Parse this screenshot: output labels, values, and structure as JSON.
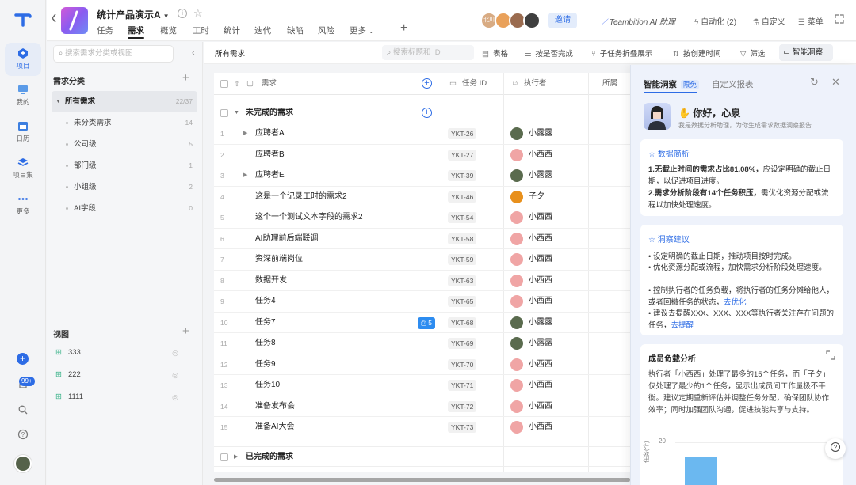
{
  "nav": {
    "items": [
      {
        "label": "项目",
        "icon": "project-icon"
      },
      {
        "label": "我的",
        "icon": "monitor-icon"
      },
      {
        "label": "日历",
        "icon": "calendar-icon"
      },
      {
        "label": "项目集",
        "icon": "layers-icon"
      },
      {
        "label": "更多",
        "icon": "more-icon"
      }
    ],
    "badge": "99+"
  },
  "header": {
    "project_title": "统计产品演示A",
    "tabs": [
      "任务",
      "需求",
      "概览",
      "工时",
      "统计",
      "迭代",
      "缺陷",
      "风险",
      "更多"
    ],
    "active_tab": "需求",
    "avatar_text": "北川",
    "invite": "邀请",
    "ai_assistant": "Teambition AI 助理",
    "automation": "自动化 (2)",
    "custom": "自定义",
    "menu": "菜单"
  },
  "sidebar": {
    "search_placeholder": "搜索需求分类或视图 ...",
    "category_title": "需求分类",
    "all_label": "所有需求",
    "all_count": "22/37",
    "categories": [
      {
        "label": "未分类需求",
        "count": "14"
      },
      {
        "label": "公司级",
        "count": "5"
      },
      {
        "label": "部门级",
        "count": "1"
      },
      {
        "label": "小组级",
        "count": "2"
      },
      {
        "label": "AI字段",
        "count": "0"
      }
    ],
    "views_title": "视图",
    "views": [
      "333",
      "222",
      "1111"
    ]
  },
  "toolbar": {
    "title": "所有需求",
    "search_placeholder": "搜索标题和 ID",
    "table": "表格",
    "by_done": "按是否完成",
    "fold": "子任务折叠展示",
    "by_created": "按创建时间",
    "filter": "筛选",
    "insight": "智能洞察"
  },
  "table": {
    "columns": [
      "需求",
      "任务 ID",
      "执行者",
      "所属"
    ],
    "group_open": "未完成的需求",
    "group_closed": "已完成的需求",
    "comment_count": "5",
    "rows": [
      {
        "n": "1",
        "name": "应聘者A",
        "id": "YKT-26",
        "assignee": "小露露",
        "twisty": true,
        "color": "#5a6b4e"
      },
      {
        "n": "2",
        "name": "应聘者B",
        "id": "YKT-27",
        "assignee": "小西西",
        "twisty": false,
        "color": "#f0a5a5"
      },
      {
        "n": "3",
        "name": "应聘者E",
        "id": "YKT-39",
        "assignee": "小露露",
        "twisty": true,
        "color": "#5a6b4e"
      },
      {
        "n": "4",
        "name": "这是一个记录工时的需求2",
        "id": "YKT-46",
        "assignee": "子夕",
        "twisty": false,
        "color": "#e8901c"
      },
      {
        "n": "5",
        "name": "这个一个测试文本字段的需求2",
        "id": "YKT-54",
        "assignee": "小西西",
        "twisty": false,
        "color": "#f0a5a5"
      },
      {
        "n": "6",
        "name": "AI助理前后端联调",
        "id": "YKT-58",
        "assignee": "小西西",
        "twisty": false,
        "color": "#f0a5a5"
      },
      {
        "n": "7",
        "name": "资深前端岗位",
        "id": "YKT-59",
        "assignee": "小西西",
        "twisty": false,
        "color": "#f0a5a5"
      },
      {
        "n": "8",
        "name": "数据开发",
        "id": "YKT-63",
        "assignee": "小西西",
        "twisty": false,
        "color": "#f0a5a5"
      },
      {
        "n": "9",
        "name": "任务4",
        "id": "YKT-65",
        "assignee": "小西西",
        "twisty": false,
        "color": "#f0a5a5"
      },
      {
        "n": "10",
        "name": "任务7",
        "id": "YKT-68",
        "assignee": "小露露",
        "twisty": false,
        "color": "#5a6b4e"
      },
      {
        "n": "11",
        "name": "任务8",
        "id": "YKT-69",
        "assignee": "小露露",
        "twisty": false,
        "color": "#5a6b4e"
      },
      {
        "n": "12",
        "name": "任务9",
        "id": "YKT-70",
        "assignee": "小西西",
        "twisty": false,
        "color": "#f0a5a5"
      },
      {
        "n": "13",
        "name": "任务10",
        "id": "YKT-71",
        "assignee": "小西西",
        "twisty": false,
        "color": "#f0a5a5"
      },
      {
        "n": "14",
        "name": "准备发布会",
        "id": "YKT-72",
        "assignee": "小西西",
        "twisty": false,
        "color": "#f0a5a5"
      },
      {
        "n": "15",
        "name": "准备AI大会",
        "id": "YKT-73",
        "assignee": "小西西",
        "twisty": false,
        "color": "#f0a5a5"
      }
    ]
  },
  "insight": {
    "tab_active": "智能洞察",
    "tag": "限免",
    "tab_other": "自定义报表",
    "greeting": "你好，心泉",
    "sub": "我是数据分析助理，为你生成需求数据洞察报告",
    "data_title": "数据简析",
    "data_p1_bold": "1.无截止时间的需求占比81.08%，",
    "data_p1": "应设定明确的截止日期，以促进项目进度。",
    "data_p2_bold": "2.需求分析阶段有14个任务积压，",
    "data_p2": "需优化资源分配或流程以加快处理速度。",
    "suggest_title": "洞察建议",
    "sug1": "• 设定明确的截止日期，推动项目按时完成。",
    "sug2": "• 优化资源分配或流程，加快需求分析阶段处理速度。",
    "sug3": "• 控制执行者的任务负载，将执行者的任务分摊给他人，或者回撤任务的状态，",
    "sug3_link": "去优化",
    "sug4": "• 建议去提醒XXX、XXX、XXX等执行者关注存在问题的任务，",
    "sug4_link": "去提醒",
    "load_title": "成员负载分析",
    "load_text": "执行者「小西西」处理了最多的15个任务，而「子夕」仅处理了最少的1个任务，显示出成员间工作量极不平衡。建议定期重新评估并调整任务分配，确保团队协作效率；同时加强团队沟通，促进技能共享与支持。",
    "axis_label": "任务(个)",
    "y_tick": "20"
  },
  "chart_data": {
    "type": "bar",
    "title": "成员负载分析",
    "ylabel": "任务(个)",
    "yticks": [
      20
    ],
    "note": "chart partially visible; first bar extends below visible area"
  },
  "colors": {
    "accent": "#2d6ce5",
    "bar": "#6bb8f0"
  }
}
